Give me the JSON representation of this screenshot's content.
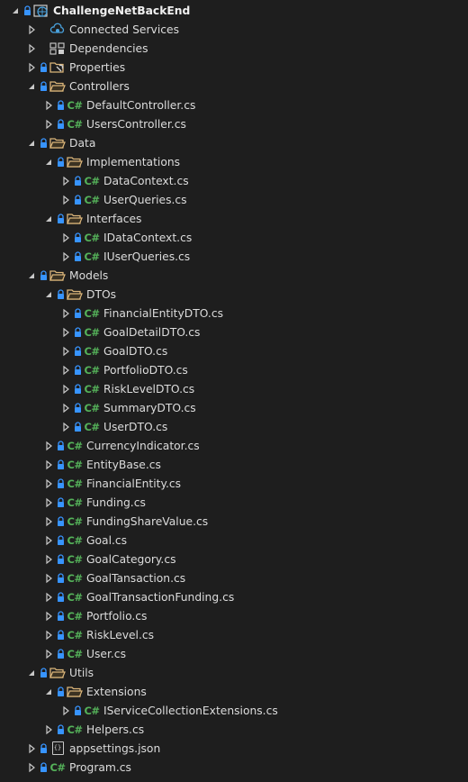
{
  "tree": [
    {
      "label": "ChallengeNetBackEnd",
      "depth": 0,
      "expander": "expanded",
      "lock": true,
      "icon": "web-project-icon",
      "bold": true
    },
    {
      "label": "Connected Services",
      "depth": 1,
      "expander": "collapsed",
      "lock": false,
      "icon": "connected-services-icon"
    },
    {
      "label": "Dependencies",
      "depth": 1,
      "expander": "collapsed",
      "lock": false,
      "icon": "dependencies-icon"
    },
    {
      "label": "Properties",
      "depth": 1,
      "expander": "collapsed",
      "lock": true,
      "icon": "properties-icon"
    },
    {
      "label": "Controllers",
      "depth": 1,
      "expander": "expanded",
      "lock": true,
      "icon": "folder-open-icon"
    },
    {
      "label": "DefaultController.cs",
      "depth": 2,
      "expander": "collapsed",
      "lock": true,
      "icon": "csharp-file-icon",
      "icon_text": "C#"
    },
    {
      "label": "UsersController.cs",
      "depth": 2,
      "expander": "collapsed",
      "lock": true,
      "icon": "csharp-file-icon",
      "icon_text": "C#"
    },
    {
      "label": "Data",
      "depth": 1,
      "expander": "expanded",
      "lock": true,
      "icon": "folder-open-icon"
    },
    {
      "label": "Implementations",
      "depth": 2,
      "expander": "expanded",
      "lock": true,
      "icon": "folder-open-icon"
    },
    {
      "label": "DataContext.cs",
      "depth": 3,
      "expander": "collapsed",
      "lock": true,
      "icon": "csharp-file-icon",
      "icon_text": "C#"
    },
    {
      "label": "UserQueries.cs",
      "depth": 3,
      "expander": "collapsed",
      "lock": true,
      "icon": "csharp-file-icon",
      "icon_text": "C#"
    },
    {
      "label": "Interfaces",
      "depth": 2,
      "expander": "expanded",
      "lock": true,
      "icon": "folder-open-icon"
    },
    {
      "label": "IDataContext.cs",
      "depth": 3,
      "expander": "collapsed",
      "lock": true,
      "icon": "csharp-file-icon",
      "icon_text": "C#"
    },
    {
      "label": "IUserQueries.cs",
      "depth": 3,
      "expander": "collapsed",
      "lock": true,
      "icon": "csharp-file-icon",
      "icon_text": "C#"
    },
    {
      "label": "Models",
      "depth": 1,
      "expander": "expanded",
      "lock": true,
      "icon": "folder-open-icon"
    },
    {
      "label": "DTOs",
      "depth": 2,
      "expander": "expanded",
      "lock": true,
      "icon": "folder-open-icon"
    },
    {
      "label": "FinancialEntityDTO.cs",
      "depth": 3,
      "expander": "collapsed",
      "lock": true,
      "icon": "csharp-file-icon",
      "icon_text": "C#"
    },
    {
      "label": "GoalDetailDTO.cs",
      "depth": 3,
      "expander": "collapsed",
      "lock": true,
      "icon": "csharp-file-icon",
      "icon_text": "C#"
    },
    {
      "label": "GoalDTO.cs",
      "depth": 3,
      "expander": "collapsed",
      "lock": true,
      "icon": "csharp-file-icon",
      "icon_text": "C#"
    },
    {
      "label": "PortfolioDTO.cs",
      "depth": 3,
      "expander": "collapsed",
      "lock": true,
      "icon": "csharp-file-icon",
      "icon_text": "C#"
    },
    {
      "label": "RiskLevelDTO.cs",
      "depth": 3,
      "expander": "collapsed",
      "lock": true,
      "icon": "csharp-file-icon",
      "icon_text": "C#"
    },
    {
      "label": "SummaryDTO.cs",
      "depth": 3,
      "expander": "collapsed",
      "lock": true,
      "icon": "csharp-file-icon",
      "icon_text": "C#"
    },
    {
      "label": "UserDTO.cs",
      "depth": 3,
      "expander": "collapsed",
      "lock": true,
      "icon": "csharp-file-icon",
      "icon_text": "C#"
    },
    {
      "label": "CurrencyIndicator.cs",
      "depth": 2,
      "expander": "collapsed",
      "lock": true,
      "icon": "csharp-file-icon",
      "icon_text": "C#"
    },
    {
      "label": "EntityBase.cs",
      "depth": 2,
      "expander": "collapsed",
      "lock": true,
      "icon": "csharp-file-icon",
      "icon_text": "C#"
    },
    {
      "label": "FinancialEntity.cs",
      "depth": 2,
      "expander": "collapsed",
      "lock": true,
      "icon": "csharp-file-icon",
      "icon_text": "C#"
    },
    {
      "label": "Funding.cs",
      "depth": 2,
      "expander": "collapsed",
      "lock": true,
      "icon": "csharp-file-icon",
      "icon_text": "C#"
    },
    {
      "label": "FundingShareValue.cs",
      "depth": 2,
      "expander": "collapsed",
      "lock": true,
      "icon": "csharp-file-icon",
      "icon_text": "C#"
    },
    {
      "label": "Goal.cs",
      "depth": 2,
      "expander": "collapsed",
      "lock": true,
      "icon": "csharp-file-icon",
      "icon_text": "C#"
    },
    {
      "label": "GoalCategory.cs",
      "depth": 2,
      "expander": "collapsed",
      "lock": true,
      "icon": "csharp-file-icon",
      "icon_text": "C#"
    },
    {
      "label": "GoalTansaction.cs",
      "depth": 2,
      "expander": "collapsed",
      "lock": true,
      "icon": "csharp-file-icon",
      "icon_text": "C#"
    },
    {
      "label": "GoalTransactionFunding.cs",
      "depth": 2,
      "expander": "collapsed",
      "lock": true,
      "icon": "csharp-file-icon",
      "icon_text": "C#"
    },
    {
      "label": "Portfolio.cs",
      "depth": 2,
      "expander": "collapsed",
      "lock": true,
      "icon": "csharp-file-icon",
      "icon_text": "C#"
    },
    {
      "label": "RiskLevel.cs",
      "depth": 2,
      "expander": "collapsed",
      "lock": true,
      "icon": "csharp-file-icon",
      "icon_text": "C#"
    },
    {
      "label": "User.cs",
      "depth": 2,
      "expander": "collapsed",
      "lock": true,
      "icon": "csharp-file-icon",
      "icon_text": "C#"
    },
    {
      "label": "Utils",
      "depth": 1,
      "expander": "expanded",
      "lock": true,
      "icon": "folder-open-icon"
    },
    {
      "label": "Extensions",
      "depth": 2,
      "expander": "expanded",
      "lock": true,
      "icon": "folder-open-icon"
    },
    {
      "label": "IServiceCollectionExtensions.cs",
      "depth": 3,
      "expander": "collapsed",
      "lock": true,
      "icon": "csharp-file-icon",
      "icon_text": "C#"
    },
    {
      "label": "Helpers.cs",
      "depth": 2,
      "expander": "collapsed",
      "lock": true,
      "icon": "csharp-file-icon",
      "icon_text": "C#"
    },
    {
      "label": "appsettings.json",
      "depth": 1,
      "expander": "collapsed",
      "lock": true,
      "icon": "json-file-icon",
      "icon_text": "{}"
    },
    {
      "label": "Program.cs",
      "depth": 1,
      "expander": "collapsed",
      "lock": true,
      "icon": "csharp-file-icon",
      "icon_text": "C#"
    }
  ],
  "colors": {
    "background": "#1e1e1e",
    "text": "#dcdcdc",
    "lock": "#3794ff",
    "csharp": "#55b35a",
    "folder": "#dcb67a",
    "arrow": "#c8c8c8"
  }
}
